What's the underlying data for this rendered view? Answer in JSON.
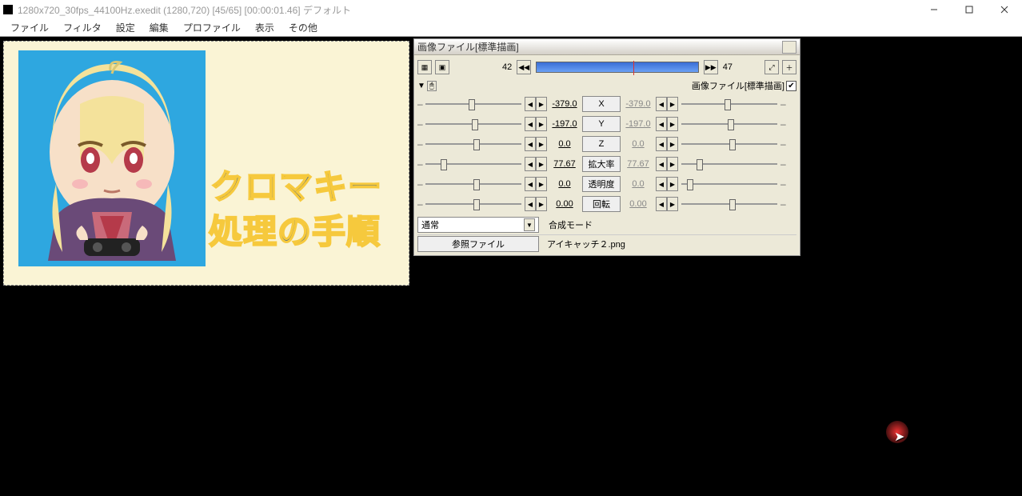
{
  "title": "1280x720_30fps_44100Hz.exedit (1280,720)  [45/65] [00:00:01.46]  デフォルト",
  "menu": {
    "file": "ファイル",
    "filter": "フィルタ",
    "settings": "設定",
    "edit": "編集",
    "profile": "プロファイル",
    "display": "表示",
    "other": "その他"
  },
  "preview": {
    "line1": "クロマキー",
    "line2": "処理の手順"
  },
  "dlg": {
    "title": "画像ファイル[標準描画]",
    "frame_start": "42",
    "frame_end": "47",
    "obj_label": "画像ファイル[標準描画]",
    "params": [
      {
        "name": "X",
        "label": "X",
        "v1": "-379.0",
        "v2": "-379.0",
        "p1": 45,
        "p2": 45
      },
      {
        "name": "Y",
        "label": "Y",
        "v1": "-197.0",
        "v2": "-197.0",
        "p1": 48,
        "p2": 48
      },
      {
        "name": "Z",
        "label": "Z",
        "v1": "0.0",
        "v2": "0.0",
        "p1": 50,
        "p2": 50
      },
      {
        "name": "scale",
        "label": "拡大率",
        "v1": "77.67",
        "v2": "77.67",
        "p1": 16,
        "p2": 16
      },
      {
        "name": "alpha",
        "label": "透明度",
        "v1": "0.0",
        "v2": "0.0",
        "p1": 50,
        "p2": 6
      },
      {
        "name": "rotate",
        "label": "回転",
        "v1": "0.00",
        "v2": "0.00",
        "p1": 50,
        "p2": 50
      }
    ],
    "blend_label": "合成モード",
    "blend_value": "通常",
    "ref_btn": "参照ファイル",
    "ref_file": "アイキャッチ２.png"
  }
}
